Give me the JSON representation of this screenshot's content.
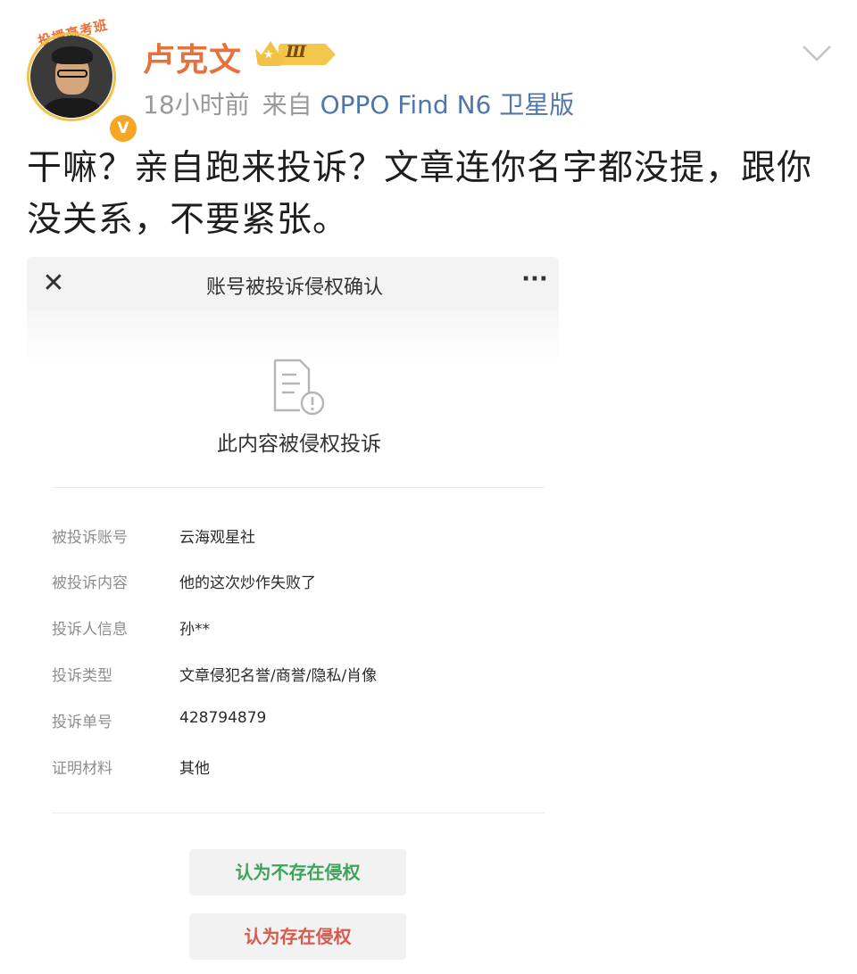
{
  "post": {
    "author": {
      "name": "卢克文",
      "avatar_banner": "投播高考班",
      "verified_icon": "verified-v-icon",
      "rank_badge": "Ⅲ",
      "rank_icon": "crown-icon"
    },
    "meta": {
      "time": "18小时前",
      "source_prefix": "来自",
      "source_name": "OPPO Find N6 卫星版"
    },
    "collapse_icon": "chevron-down-icon",
    "text": "干嘛？亲自跑来投诉？文章连你名字都没提，跟你没关系，不要紧张。"
  },
  "embedded_screenshot": {
    "header": {
      "close_icon": "close-icon",
      "title": "账号被投诉侵权确认",
      "more_icon": "more-icon"
    },
    "notice_icon": "document-warning-icon",
    "notice_title": "此内容被侵权投诉",
    "details": [
      {
        "label": "被投诉账号",
        "value": "云海观星社"
      },
      {
        "label": "被投诉内容",
        "value": "他的这次炒作失败了"
      },
      {
        "label": "投诉人信息",
        "value": "孙**"
      },
      {
        "label": "投诉类型",
        "value": "文章侵犯名誉/商誉/隐私/肖像"
      },
      {
        "label": "投诉单号",
        "value": "428794879"
      },
      {
        "label": "证明材料",
        "value": "其他"
      }
    ],
    "buttons": {
      "no_infringement": "认为不存在侵权",
      "infringement": "认为存在侵权"
    }
  },
  "colors": {
    "username": "#e8713a",
    "source_link": "#5176a8",
    "meta_gray": "#9a9a9a",
    "accept_green": "#3fa35a",
    "reject_red": "#d65a4e"
  }
}
